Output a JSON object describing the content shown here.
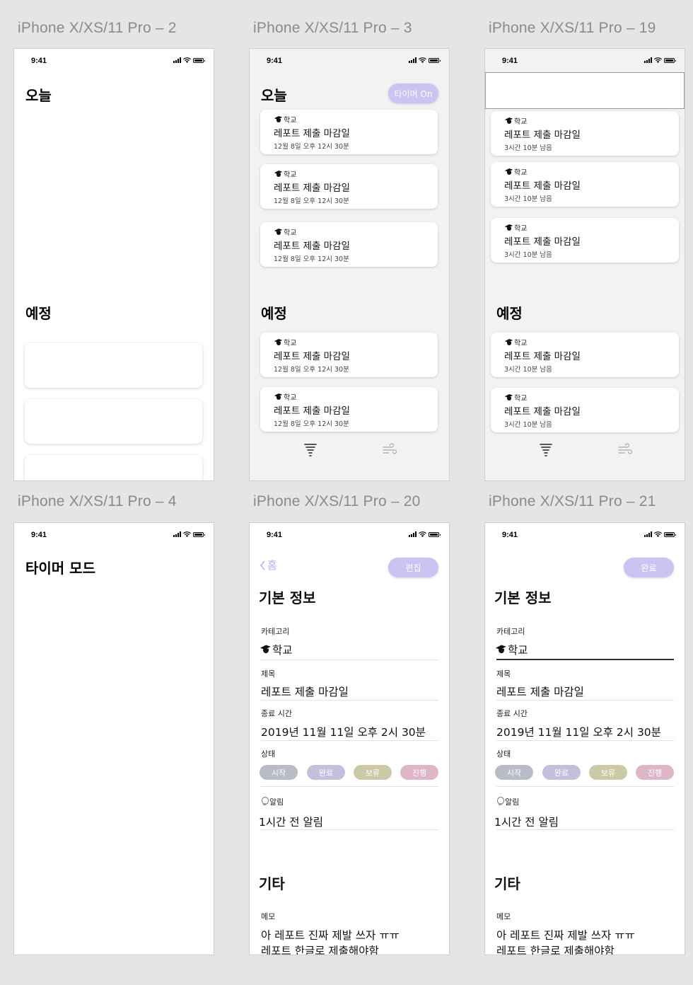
{
  "frames": {
    "f2": "iPhone X/XS/11 Pro – 2",
    "f3": "iPhone X/XS/11 Pro – 3",
    "f19": "iPhone X/XS/11 Pro – 19",
    "f4": "iPhone X/XS/11 Pro – 4",
    "f20": "iPhone X/XS/11 Pro – 20",
    "f21": "iPhone X/XS/11 Pro – 21"
  },
  "status_time": "9:41",
  "home": {
    "today_title": "오늘",
    "upcoming_title": "예정",
    "timer_button": "타이머 On",
    "card": {
      "category": "학교",
      "title": "레포트 제출 마감일",
      "date": "12월 8일 오후 12시 30분",
      "remaining": "3시간 10분 남음"
    }
  },
  "timer_mode": {
    "title": "타이머 모드"
  },
  "detail": {
    "back_label": "홈",
    "edit_label": "편집",
    "done_label": "완료",
    "basic_info": "기본 정보",
    "category_label": "카테고리",
    "category_value": "학교",
    "title_label": "제목",
    "title_value": "레포트 제출 마감일",
    "end_time_label": "종료 시간",
    "end_time_value": "2019년 11월 11일 오후 2시 30분",
    "status_label": "상태",
    "status_chips": [
      "시작",
      "완료",
      "보류",
      "진행"
    ],
    "alarm_label": "알림",
    "alarm_value": "1시간 전 알림",
    "etc_title": "기타",
    "memo_label": "메모",
    "memo_line1": "아 레포트 진짜 제발 쓰자 ㅠㅠ",
    "memo_line2": "레포트 한글로 제출해야함"
  },
  "colors": {
    "accent": "#c9c4f2",
    "chip_start": "#b9bcc6",
    "chip_done": "#c3bfdc",
    "chip_hold": "#cccaa6",
    "chip_progress": "#deb6c8"
  }
}
